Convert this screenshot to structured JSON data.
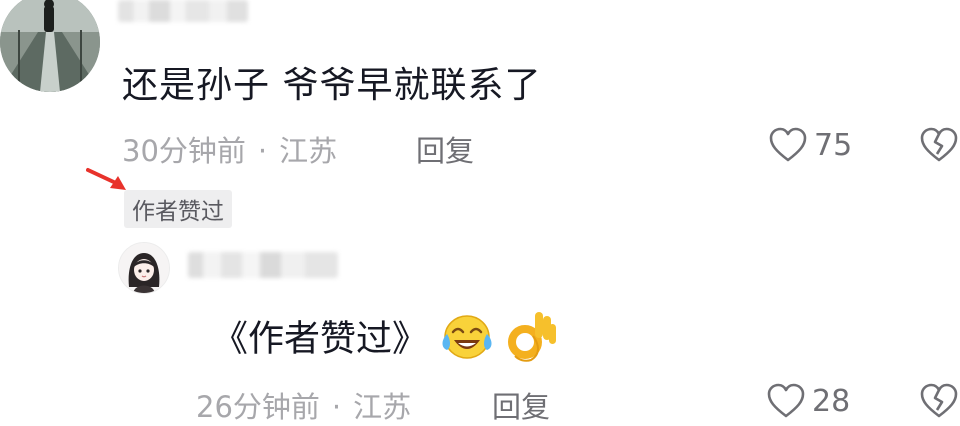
{
  "comment": {
    "text": "还是孙子 爷爷早就联系了",
    "time": "30分钟前",
    "separator": "·",
    "location": "江苏",
    "reply_label": "回复",
    "likes": "75",
    "author_badge": "作者赞过"
  },
  "reply": {
    "text": "《作者赞过》",
    "emojis": [
      "crying-laughing-emoji",
      "ok-hand-emoji"
    ],
    "time": "26分钟前",
    "separator": "·",
    "location": "江苏",
    "reply_label": "回复",
    "likes": "28"
  },
  "colors": {
    "text": "#161823",
    "meta": "#a7a7ab",
    "icon": "#6f6f74",
    "badge_bg": "#eeeeef",
    "annotation_arrow": "#e8322b"
  }
}
